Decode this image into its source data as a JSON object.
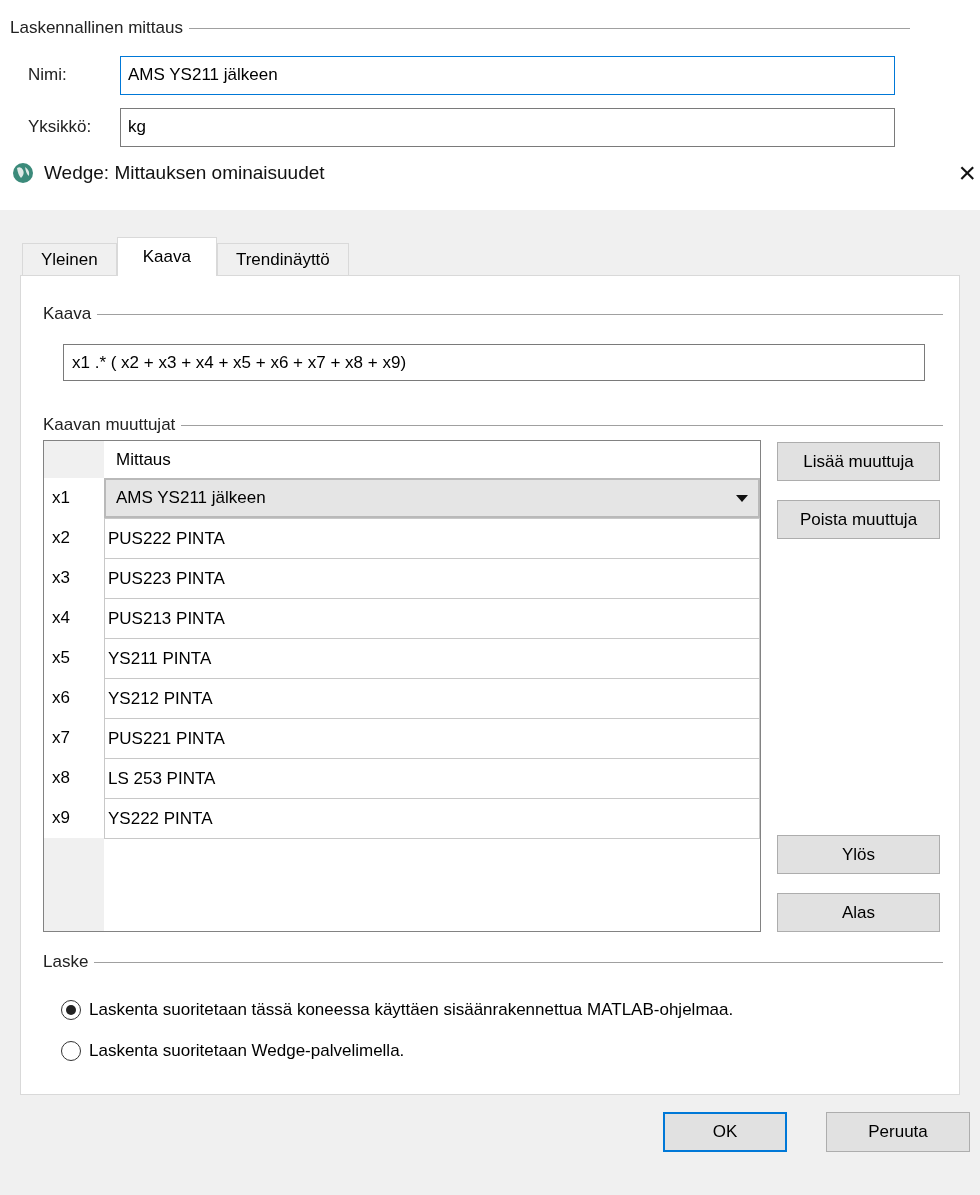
{
  "computed_group": {
    "legend": "Laskennallinen mittaus",
    "fields": [
      {
        "label": "Nimi:",
        "value": "AMS YS211 jälkeen",
        "focused": true
      },
      {
        "label": "Yksikkö:",
        "value": "kg",
        "focused": false
      }
    ]
  },
  "window": {
    "title": "Wedge: Mittauksen ominaisuudet",
    "close": "×"
  },
  "tabs": [
    {
      "label": "Yleinen",
      "selected": false
    },
    {
      "label": "Kaava",
      "selected": true
    },
    {
      "label": "Trendinäyttö",
      "selected": false
    }
  ],
  "formula": {
    "legend": "Kaava",
    "value": "x1 .* ( x2 + x3 + x4 + x5 + x6 + x7 + x8 + x9)"
  },
  "variables": {
    "legend": "Kaavan muuttujat",
    "column": "Mittaus",
    "rows": [
      {
        "name": "x1",
        "measurement": "AMS YS211 jälkeen",
        "kind": "dropdown"
      },
      {
        "name": "x2",
        "measurement": "PUS222 PINTA",
        "kind": "text"
      },
      {
        "name": "x3",
        "measurement": "PUS223 PINTA",
        "kind": "text"
      },
      {
        "name": "x4",
        "measurement": "PUS213 PINTA",
        "kind": "text"
      },
      {
        "name": "x5",
        "measurement": "YS211 PINTA",
        "kind": "text"
      },
      {
        "name": "x6",
        "measurement": "YS212 PINTA",
        "kind": "text"
      },
      {
        "name": "x7",
        "measurement": "PUS221 PINTA",
        "kind": "text"
      },
      {
        "name": "x8",
        "measurement": "LS 253 PINTA",
        "kind": "text"
      },
      {
        "name": "x9",
        "measurement": "YS222 PINTA",
        "kind": "text"
      }
    ],
    "buttons_top": [
      "Lisää muuttuja",
      "Poista muuttuja"
    ],
    "buttons_bottom": [
      "Ylös",
      "Alas"
    ]
  },
  "calculate": {
    "legend": "Laske",
    "options": [
      {
        "label": "Laskenta suoritetaan tässä koneessa käyttäen sisäänrakennettua MATLAB-ohjelmaa.",
        "selected": true
      },
      {
        "label": "Laskenta suoritetaan Wedge-palvelimella.",
        "selected": false
      }
    ]
  },
  "buttons": [
    {
      "label": "OK",
      "default": true
    },
    {
      "label": "Peruuta",
      "default": false
    }
  ]
}
